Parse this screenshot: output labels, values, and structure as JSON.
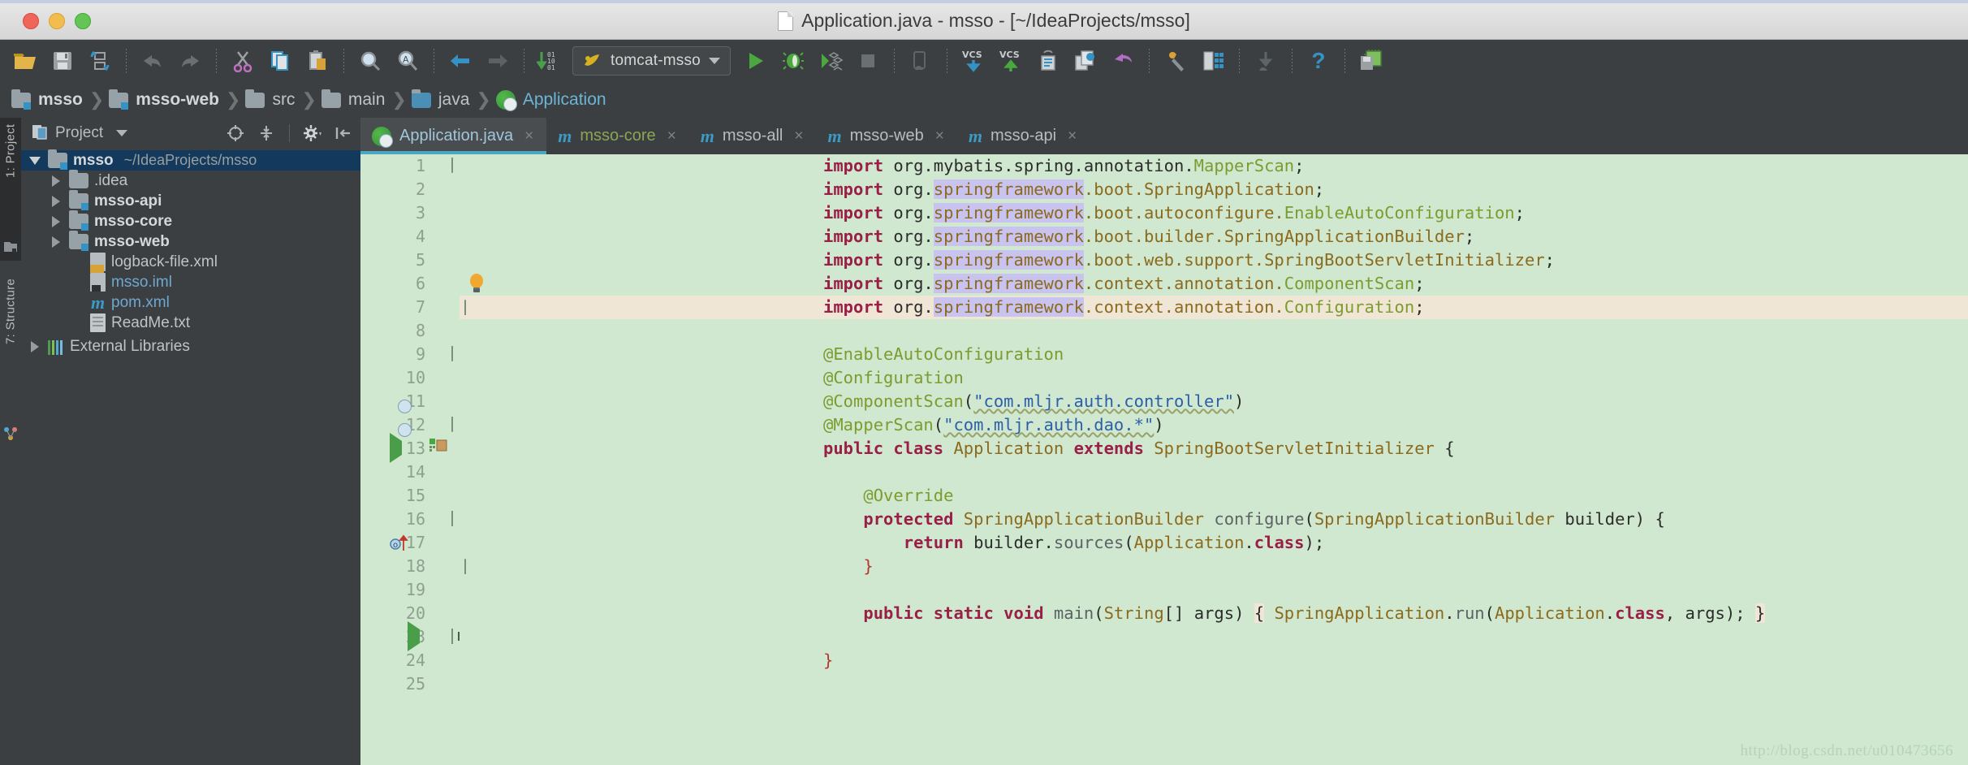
{
  "window": {
    "title": "Application.java - msso - [~/IdeaProjects/msso]",
    "traffic_lights": [
      "close",
      "minimize",
      "zoom"
    ]
  },
  "toolbar": {
    "icons": [
      "open-folder-icon",
      "save-all-icon",
      "sync-icon",
      "undo-icon",
      "redo-icon",
      "cut-icon",
      "copy-icon",
      "paste-icon",
      "find-icon",
      "replace-icon",
      "back-icon",
      "forward-icon",
      "compile-icon"
    ],
    "run_config": "tomcat-msso",
    "run_label": "Run",
    "debug_label": "Debug",
    "run_coverage_label": "Run with Coverage",
    "stop_label": "Stop",
    "attach_label": "Attach debugger",
    "vcs_update_label": "VCS",
    "vcs_commit_label": "VCS",
    "history_label": "History",
    "diff_label": "Compare",
    "rollback_label": "Rollback",
    "settings_label": "Settings",
    "structure_label": "Project Structure",
    "sdk_label": "SDK Manager",
    "help_label": "?",
    "memory_label": "Memory"
  },
  "breadcrumb": [
    {
      "label": "msso",
      "icon": "module-folder-icon",
      "type": "module"
    },
    {
      "label": "msso-web",
      "icon": "module-folder-icon",
      "type": "module"
    },
    {
      "label": "src",
      "icon": "folder-icon",
      "type": "folder"
    },
    {
      "label": "main",
      "icon": "folder-icon",
      "type": "folder"
    },
    {
      "label": "java",
      "icon": "source-folder-icon",
      "type": "source"
    },
    {
      "label": "Application",
      "icon": "spring-class-icon",
      "type": "class"
    }
  ],
  "tool_tabs": [
    {
      "label": "1: Project",
      "icon": "project-icon",
      "active": true
    },
    {
      "label": "7: Structure",
      "icon": "structure-icon",
      "active": false
    }
  ],
  "project_panel": {
    "title": "Project",
    "selected_scope": "Project",
    "buttons": [
      "locate-icon",
      "collapse-all-icon",
      "gear-icon",
      "hide-icon"
    ],
    "tree": [
      {
        "label": "msso",
        "path": "~/IdeaProjects/msso",
        "icon": "module-folder-icon",
        "indent": 0,
        "twisty": "down",
        "selected": true,
        "bold": true
      },
      {
        "label": ".idea",
        "icon": "folder-icon",
        "indent": 1,
        "twisty": "right"
      },
      {
        "label": "msso-api",
        "icon": "module-folder-icon",
        "indent": 1,
        "twisty": "right",
        "bold": true
      },
      {
        "label": "msso-core",
        "icon": "module-folder-icon",
        "indent": 1,
        "twisty": "right",
        "bold": true
      },
      {
        "label": "msso-web",
        "icon": "module-folder-icon",
        "indent": 1,
        "twisty": "right",
        "bold": true
      },
      {
        "label": "logback-file.xml",
        "icon": "xml-file-icon",
        "indent": 2,
        "twisty": "none"
      },
      {
        "label": "msso.iml",
        "icon": "iml-file-icon",
        "indent": 2,
        "twisty": "none",
        "blue": true
      },
      {
        "label": "pom.xml",
        "icon": "maven-file-icon",
        "indent": 2,
        "twisty": "none",
        "blue": true
      },
      {
        "label": "ReadMe.txt",
        "icon": "text-file-icon",
        "indent": 2,
        "twisty": "none"
      },
      {
        "label": "External Libraries",
        "icon": "libraries-icon",
        "indent": 0,
        "twisty": "right"
      }
    ]
  },
  "editor_tabs": [
    {
      "label": "Application.java",
      "icon": "spring-class-icon",
      "active": true,
      "close": "×"
    },
    {
      "label": "msso-core",
      "icon": "maven-file-icon",
      "active": false,
      "close": "×",
      "green": true
    },
    {
      "label": "msso-all",
      "icon": "maven-file-icon",
      "active": false,
      "close": "×"
    },
    {
      "label": "msso-web",
      "icon": "maven-file-icon",
      "active": false,
      "close": "×"
    },
    {
      "label": "msso-api",
      "icon": "maven-file-icon",
      "active": false,
      "close": "×"
    }
  ],
  "editor": {
    "file": "Application.java",
    "language": "java",
    "caret_line": 7,
    "line_numbers": [
      "1",
      "2",
      "3",
      "4",
      "5",
      "6",
      "7",
      "8",
      "9",
      "10",
      "11",
      "12",
      "13",
      "14",
      "15",
      "16",
      "17",
      "18",
      "19",
      "20",
      "23",
      "24",
      "25"
    ],
    "lines": [
      "import org.mybatis.spring.annotation.MapperScan;",
      "import org.springframework.boot.SpringApplication;",
      "import org.springframework.boot.autoconfigure.EnableAutoConfiguration;",
      "import org.springframework.boot.builder.SpringApplicationBuilder;",
      "import org.springframework.boot.web.support.SpringBootServletInitializer;",
      "import org.springframework.context.annotation.ComponentScan;",
      "import org.springframework.context.annotation.Configuration;",
      "",
      "@EnableAutoConfiguration",
      "@Configuration",
      "@ComponentScan(\"com.mljr.auth.controller\")",
      "@MapperScan(\"com.mljr.auth.dao.*\")",
      "public class Application extends SpringBootServletInitializer {",
      "",
      "    @Override",
      "    protected SpringApplicationBuilder configure(SpringApplicationBuilder builder) {",
      "        return builder.sources(Application.class);",
      "    }",
      "",
      "    public static void main(String[] args) { SpringApplication.run(Application.class, args); }",
      "",
      "}",
      ""
    ],
    "highlighted_identifier": "springframework",
    "gutter_markers": [
      {
        "line": 11,
        "icon": "spring-bean-icon"
      },
      {
        "line": 13,
        "icon": "run-class-icon"
      },
      {
        "line": 13,
        "icon": "spring-bean-icon"
      },
      {
        "line": 13,
        "icon": "spring-config-icon"
      },
      {
        "line": 16,
        "icon": "overriding-method-icon"
      },
      {
        "line": 20,
        "icon": "run-method-icon"
      }
    ],
    "intention_bulb": {
      "line": 6,
      "icon": "intention-bulb-icon"
    }
  },
  "watermark": "http://blog.csdn.net/u010473656",
  "colors": {
    "chrome": "#3c3f41",
    "editor_bg": "#cfe8cf",
    "selection": "#133a5c",
    "accent": "#4ba6c4",
    "caret_line": "#f0e6d6",
    "identifier_highlight": "#c9c3f0"
  }
}
